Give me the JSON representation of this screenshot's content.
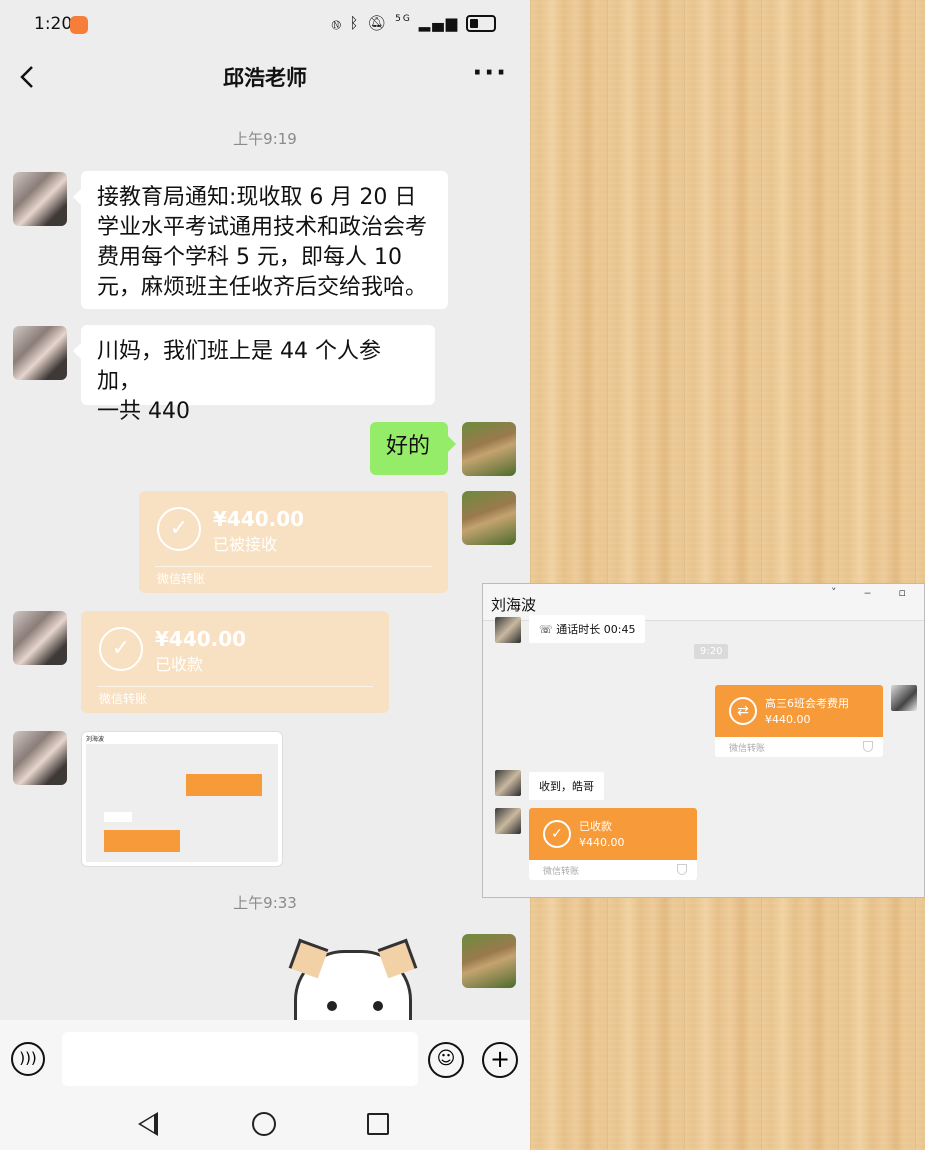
{
  "status_bar": {
    "time": "1:20",
    "signal": "5G"
  },
  "header": {
    "title": "邱浩老师",
    "more": "···"
  },
  "messages": {
    "time1": "上午9:19",
    "m1": [
      "接教育局通知:现收取 6 月 20 日",
      "学业水平考试通用技术和政治会考",
      "费用每个学科 5 元，即每人 10",
      "元，麻烦班主任收齐后交给我哈。"
    ],
    "m2": [
      "川妈，我们班上是 44 个人参加，",
      "一共 440"
    ],
    "m3": "好的",
    "transfer1": {
      "amount": "¥440.00",
      "status": "已被接收",
      "footer": "微信转账"
    },
    "transfer2": {
      "amount": "¥440.00",
      "status": "已收款",
      "footer": "微信转账"
    },
    "time2": "上午9:33"
  },
  "thumbnail": {
    "name": "刘海波"
  },
  "input_bar": {
    "placeholder": ""
  },
  "desktop_window": {
    "title": "刘海波",
    "call": "通话时长 00:45",
    "time": "9:20",
    "transfer_out": {
      "line1": "高三6班会考费用",
      "line2": "¥440.00",
      "footer": "微信转账"
    },
    "reply": "收到，皓哥",
    "transfer_in": {
      "line1": "已收款",
      "line2": "¥440.00",
      "footer": "微信转账"
    }
  },
  "colors": {
    "green_bubble": "#95ec69",
    "transfer_faded": "#f8e0c2",
    "transfer_orange": "#f79b3a"
  }
}
